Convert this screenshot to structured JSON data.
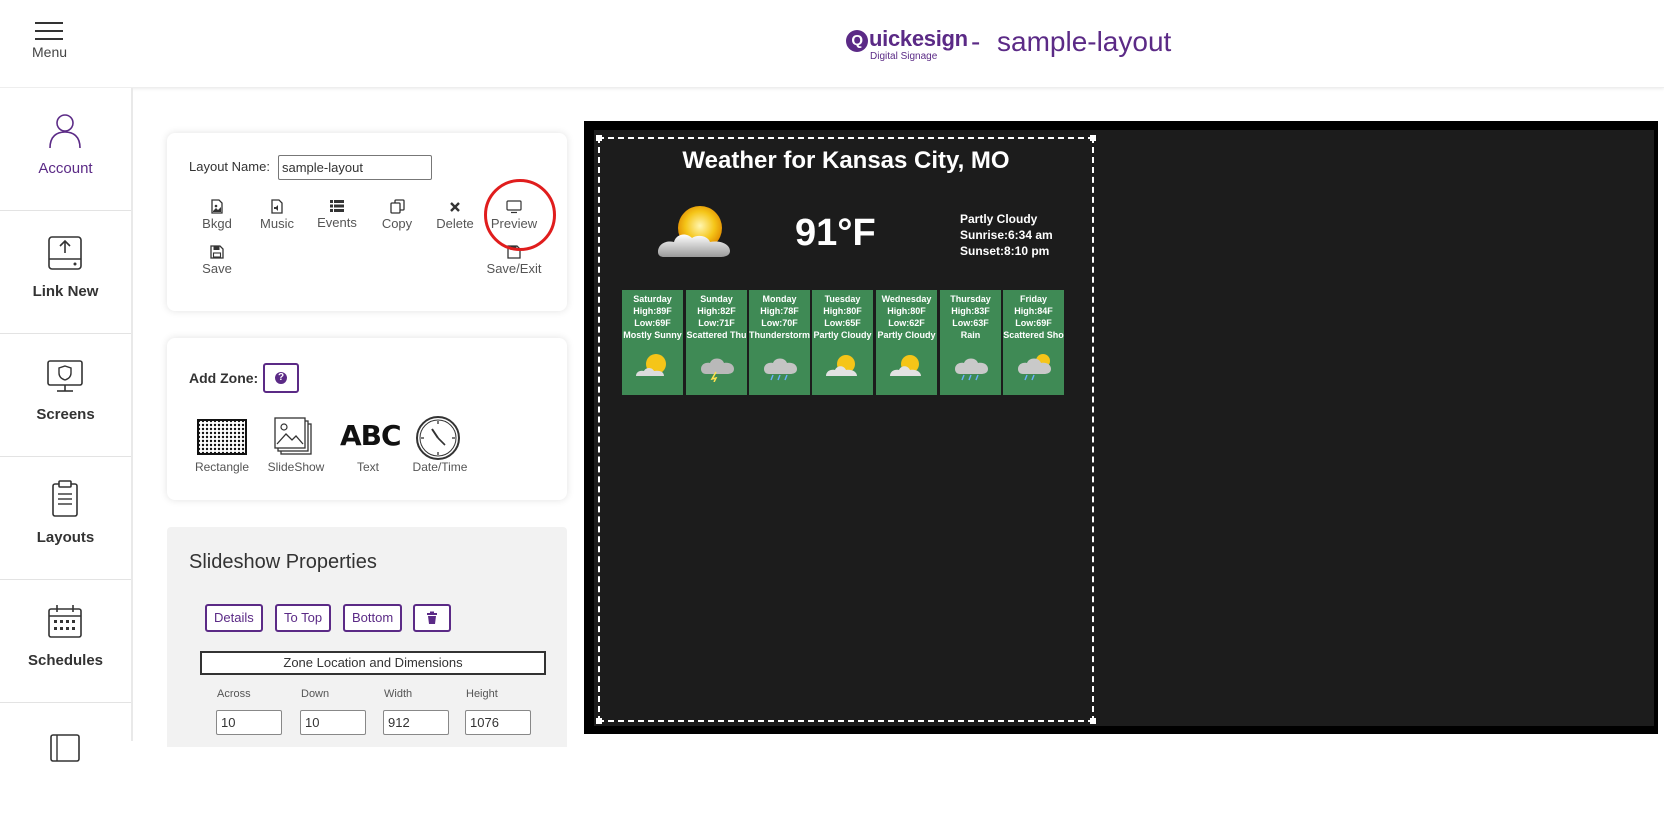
{
  "topbar": {
    "menu_label": "Menu",
    "logo_main": "uickesign",
    "logo_q": "Q",
    "logo_sub": "Digital Signage",
    "separator": "-",
    "page_title": "sample-layout"
  },
  "sidebar": {
    "items": [
      {
        "label": "Account",
        "icon": "user-icon"
      },
      {
        "label": "Link New",
        "icon": "upload-drive-icon"
      },
      {
        "label": "Screens",
        "icon": "monitor-shield-icon"
      },
      {
        "label": "Layouts",
        "icon": "clipboard-icon"
      },
      {
        "label": "Schedules",
        "icon": "calendar-icon"
      }
    ]
  },
  "layout_card": {
    "name_label": "Layout Name:",
    "name_value": "sample-layout",
    "tools": {
      "bkgd": "Bkgd",
      "music": "Music",
      "events": "Events",
      "copy": "Copy",
      "delete": "Delete",
      "preview": "Preview",
      "save": "Save",
      "save_exit": "Save/Exit"
    }
  },
  "add_zone": {
    "label": "Add Zone:",
    "help_glyph": "?",
    "tools": {
      "rectangle": "Rectangle",
      "slideshow": "SlideShow",
      "text": "Text",
      "text_glyph": "ABC",
      "datetime": "Date/Time"
    }
  },
  "props": {
    "title": "Slideshow Properties",
    "buttons": {
      "details": "Details",
      "to_top": "To Top",
      "bottom": "Bottom"
    },
    "zone_loc": "Zone Location and Dimensions",
    "dims": {
      "across_label": "Across",
      "across_value": "10",
      "down_label": "Down",
      "down_value": "10",
      "width_label": "Width",
      "width_value": "912",
      "height_label": "Height",
      "height_value": "1076"
    }
  },
  "weather": {
    "title": "Weather for Kansas City, MO",
    "temp": "91°F",
    "condition": "Partly Cloudy",
    "sunrise": "Sunrise:6:34 am",
    "sunset": "Sunset:8:10 pm",
    "days": [
      {
        "day": "Saturday",
        "high": "High:89F",
        "low": "Low:69F",
        "desc": "Mostly Sunny",
        "icon": "sun-icon"
      },
      {
        "day": "Sunday",
        "high": "High:82F",
        "low": "Low:71F",
        "desc": "Scattered Thu",
        "icon": "storm-icon"
      },
      {
        "day": "Monday",
        "high": "High:78F",
        "low": "Low:70F",
        "desc": "Thunderstorms",
        "icon": "storm-icon"
      },
      {
        "day": "Tuesday",
        "high": "High:80F",
        "low": "Low:65F",
        "desc": "Partly Cloudy",
        "icon": "partly-cloudy-icon"
      },
      {
        "day": "Wednesday",
        "high": "High:80F",
        "low": "Low:62F",
        "desc": "Partly Cloudy",
        "icon": "partly-cloudy-icon"
      },
      {
        "day": "Thursday",
        "high": "High:83F",
        "low": "Low:63F",
        "desc": "Rain",
        "icon": "rain-icon"
      },
      {
        "day": "Friday",
        "high": "High:84F",
        "low": "Low:69F",
        "desc": "Scattered Sho",
        "icon": "showers-icon"
      }
    ]
  },
  "colors": {
    "brand": "#5b2a86",
    "tile_green": "#3f8a55",
    "highlight_red": "#e01d1d"
  }
}
